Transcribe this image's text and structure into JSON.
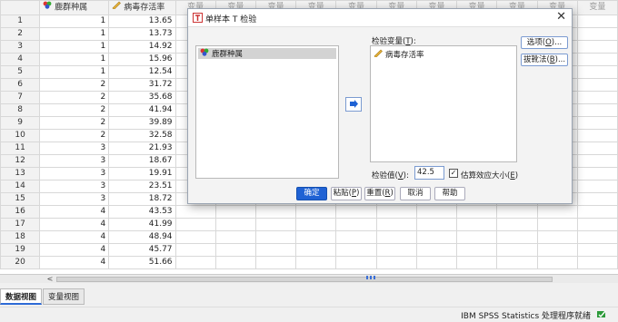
{
  "grid": {
    "columns": [
      {
        "label": "鹿群种属",
        "icon": "nominal-measure-icon"
      },
      {
        "label": "病毒存活率",
        "icon": "scale-measure-icon"
      }
    ],
    "empty_column_label": "变量",
    "rows": [
      {
        "n": "1",
        "a": "1",
        "b": "13.65"
      },
      {
        "n": "2",
        "a": "1",
        "b": "13.73"
      },
      {
        "n": "3",
        "a": "1",
        "b": "14.92"
      },
      {
        "n": "4",
        "a": "1",
        "b": "15.96"
      },
      {
        "n": "5",
        "a": "1",
        "b": "12.54"
      },
      {
        "n": "6",
        "a": "2",
        "b": "31.72"
      },
      {
        "n": "7",
        "a": "2",
        "b": "35.68"
      },
      {
        "n": "8",
        "a": "2",
        "b": "41.94"
      },
      {
        "n": "9",
        "a": "2",
        "b": "39.89"
      },
      {
        "n": "10",
        "a": "2",
        "b": "32.58"
      },
      {
        "n": "11",
        "a": "3",
        "b": "21.93"
      },
      {
        "n": "12",
        "a": "3",
        "b": "18.67"
      },
      {
        "n": "13",
        "a": "3",
        "b": "19.91"
      },
      {
        "n": "14",
        "a": "3",
        "b": "23.51"
      },
      {
        "n": "15",
        "a": "3",
        "b": "18.72"
      },
      {
        "n": "16",
        "a": "4",
        "b": "43.53"
      },
      {
        "n": "17",
        "a": "4",
        "b": "41.99"
      },
      {
        "n": "18",
        "a": "4",
        "b": "48.94"
      },
      {
        "n": "19",
        "a": "4",
        "b": "45.77"
      },
      {
        "n": "20",
        "a": "4",
        "b": "51.66"
      }
    ]
  },
  "tabs": {
    "data_view": "数据视图",
    "variable_view": "变量视图"
  },
  "status": {
    "text": "IBM SPSS Statistics 处理程序就绪"
  },
  "dialog": {
    "title": "单样本 T 检验",
    "source_items": [
      "鹿群种属"
    ],
    "test_variables_label": "检验变量(",
    "test_variables_key": "T",
    "test_variables_suffix": "):",
    "test_variables": [
      "病毒存活率"
    ],
    "options_label": "选项(",
    "options_key": "O",
    "options_suffix": ")...",
    "bootstrap_label": "拔靴法(",
    "bootstrap_key": "B",
    "bootstrap_suffix": ")...",
    "test_value_label": "检验值(",
    "test_value_key": "V",
    "test_value_suffix": "):",
    "test_value": "42.5",
    "effect_size_label": "估算效应大小(",
    "effect_size_key": "E",
    "effect_size_suffix": ")",
    "effect_size_checked": "✓",
    "ok": "确定",
    "paste_label": "粘贴(",
    "paste_key": "P",
    "paste_suffix": ")",
    "reset_label": "重置(",
    "reset_key": "R",
    "reset_suffix": ")",
    "cancel": "取消",
    "help": "帮助",
    "close": "✕"
  },
  "colors": {
    "accent": "#1f62d4"
  }
}
